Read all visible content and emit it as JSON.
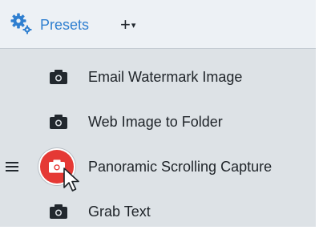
{
  "header": {
    "presets_label": "Presets",
    "add_label": "+",
    "add_caret": "▾",
    "icon": "gear-icon"
  },
  "presets": [
    {
      "label": "Email Watermark Image",
      "icon": "camera-icon",
      "active": false
    },
    {
      "label": "Web Image to Folder",
      "icon": "camera-icon",
      "active": false
    },
    {
      "label": "Panoramic Scrolling Capture",
      "icon": "camera-icon",
      "active": true
    },
    {
      "label": "Grab Text",
      "icon": "camera-icon",
      "active": false
    }
  ],
  "colors": {
    "accent": "#2f7fd0",
    "record": "#e53935",
    "panel": "#dde2e6",
    "header": "#edf1f5"
  }
}
